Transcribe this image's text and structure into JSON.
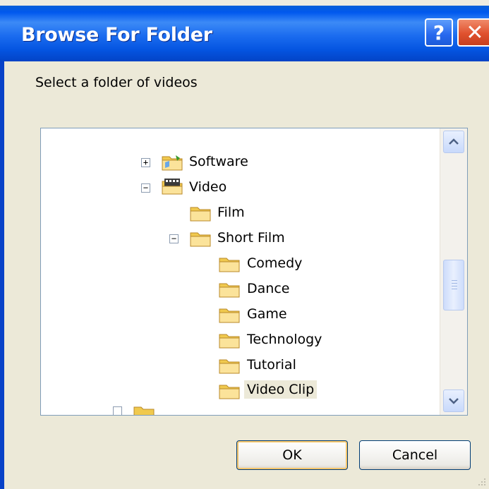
{
  "window": {
    "title": "Browse For Folder",
    "help_glyph": "?",
    "close_glyph": "✕"
  },
  "instruction": "Select a folder of videos",
  "tree": {
    "nodes": [
      {
        "label": "Software",
        "expander": "+",
        "icon": "shared-folder-icon"
      },
      {
        "label": "Video",
        "expander": "−",
        "icon": "video-folder-icon"
      },
      {
        "label": "Film",
        "expander": "",
        "icon": "folder-icon"
      },
      {
        "label": "Short Film",
        "expander": "−",
        "icon": "folder-icon"
      },
      {
        "label": "Comedy",
        "expander": "",
        "icon": "folder-icon"
      },
      {
        "label": "Dance",
        "expander": "",
        "icon": "folder-icon"
      },
      {
        "label": "Game",
        "expander": "",
        "icon": "folder-icon"
      },
      {
        "label": "Technology",
        "expander": "",
        "icon": "folder-icon"
      },
      {
        "label": "Tutorial",
        "expander": "",
        "icon": "folder-icon"
      },
      {
        "label": "Video Clip",
        "expander": "",
        "icon": "folder-icon",
        "selected": true
      }
    ]
  },
  "buttons": {
    "ok": "OK",
    "cancel": "Cancel"
  },
  "colors": {
    "titlebar": "#0058ee",
    "dialog_bg": "#ece9d8",
    "folder": "#f5d46a",
    "close": "#e0512e"
  }
}
